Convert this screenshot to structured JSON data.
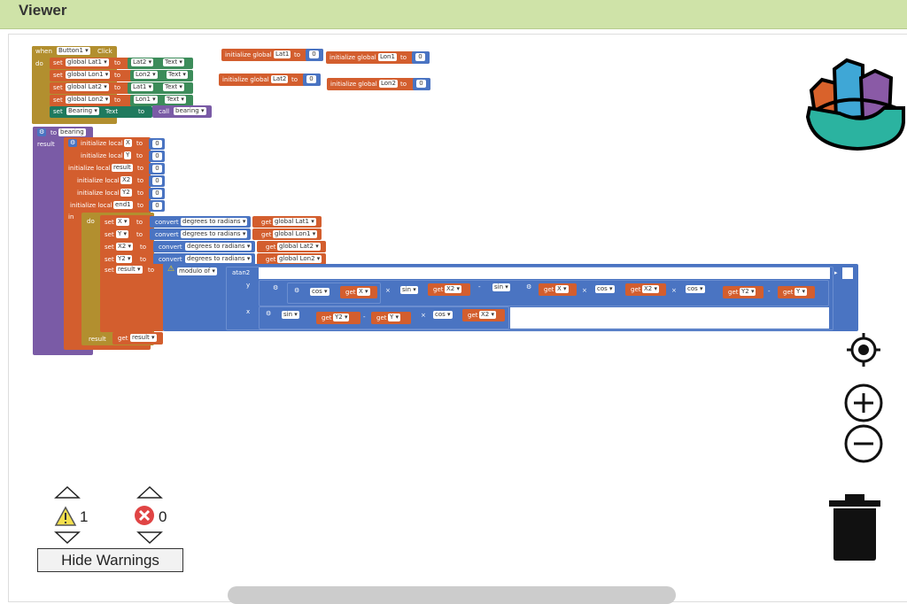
{
  "header": {
    "title": "Viewer"
  },
  "event": {
    "when": "when",
    "component": "Button1",
    "event": "Click",
    "do": "do"
  },
  "sets": [
    {
      "set": "set",
      "var": "global Lat1",
      "to": "to",
      "comp": "Lat2",
      "prop": "Text"
    },
    {
      "set": "set",
      "var": "global Lon1",
      "to": "to",
      "comp": "Lon2",
      "prop": "Text"
    },
    {
      "set": "set",
      "var": "global Lat2",
      "to": "to",
      "comp": "Lat1",
      "prop": "Text"
    },
    {
      "set": "set",
      "var": "global Lon2",
      "to": "to",
      "comp": "Lon1",
      "prop": "Text"
    }
  ],
  "bearing_set": {
    "set": "set",
    "comp": "Bearing",
    "prop": "Text",
    "to": "to",
    "call": "call",
    "proc": "bearing"
  },
  "globals": [
    {
      "label": "initialize global",
      "name": "Lat1",
      "to": "to",
      "val": "0"
    },
    {
      "label": "initialize global",
      "name": "Lon1",
      "to": "to",
      "val": "0"
    },
    {
      "label": "initialize global",
      "name": "Lat2",
      "to": "to",
      "val": "0"
    },
    {
      "label": "initialize global",
      "name": "Lon2",
      "to": "to",
      "val": "0"
    }
  ],
  "proc": {
    "to": "to",
    "name": "bearing",
    "result": "result",
    "in": "in",
    "do": "do",
    "get": "get"
  },
  "locals": [
    {
      "label": "initialize local",
      "name": "X",
      "to": "to",
      "val": "0"
    },
    {
      "label": "initialize local",
      "name": "Y",
      "to": "to",
      "val": "0"
    },
    {
      "label": "initialize local",
      "name": "result",
      "to": "to",
      "val": "0"
    },
    {
      "label": "initialize local",
      "name": "X2",
      "to": "to",
      "val": "0"
    },
    {
      "label": "initialize local",
      "name": "Y2",
      "to": "to",
      "val": "0"
    },
    {
      "label": "initialize local",
      "name": "end1",
      "to": "to",
      "val": "0"
    }
  ],
  "converts": [
    {
      "set": "set",
      "var": "X",
      "to": "to",
      "convert": "convert",
      "mode": "degrees to radians",
      "get": "get",
      "src": "global Lat1"
    },
    {
      "set": "set",
      "var": "Y",
      "to": "to",
      "convert": "convert",
      "mode": "degrees to radians",
      "get": "get",
      "src": "global Lon1"
    },
    {
      "set": "set",
      "var": "X2",
      "to": "to",
      "convert": "convert",
      "mode": "degrees to radians",
      "get": "get",
      "src": "global Lat2"
    },
    {
      "set": "set",
      "var": "Y2",
      "to": "to",
      "convert": "convert",
      "mode": "degrees to radians",
      "get": "get",
      "src": "global Lon2"
    }
  ],
  "formula": {
    "set": "set",
    "var": "result",
    "to": "to",
    "modulo": "modulo of",
    "atan2": "atan2",
    "y": "y",
    "x": "x",
    "times": "×",
    "minus": "-",
    "cos": "cos",
    "sin": "sin",
    "get": "get",
    "v_x": "X",
    "v_x2": "X2",
    "v_y": "Y",
    "v_y2": "Y2"
  },
  "warnings": {
    "warn_count": "1",
    "error_count": "0",
    "hide_label": "Hide Warnings"
  },
  "colors": {
    "header": "#cfe3a8",
    "procedure": "#7a5ba6",
    "variable": "#d35e2e",
    "control": "#b28f2f",
    "math": "#4a74c2",
    "component": "#3c8c5a"
  }
}
